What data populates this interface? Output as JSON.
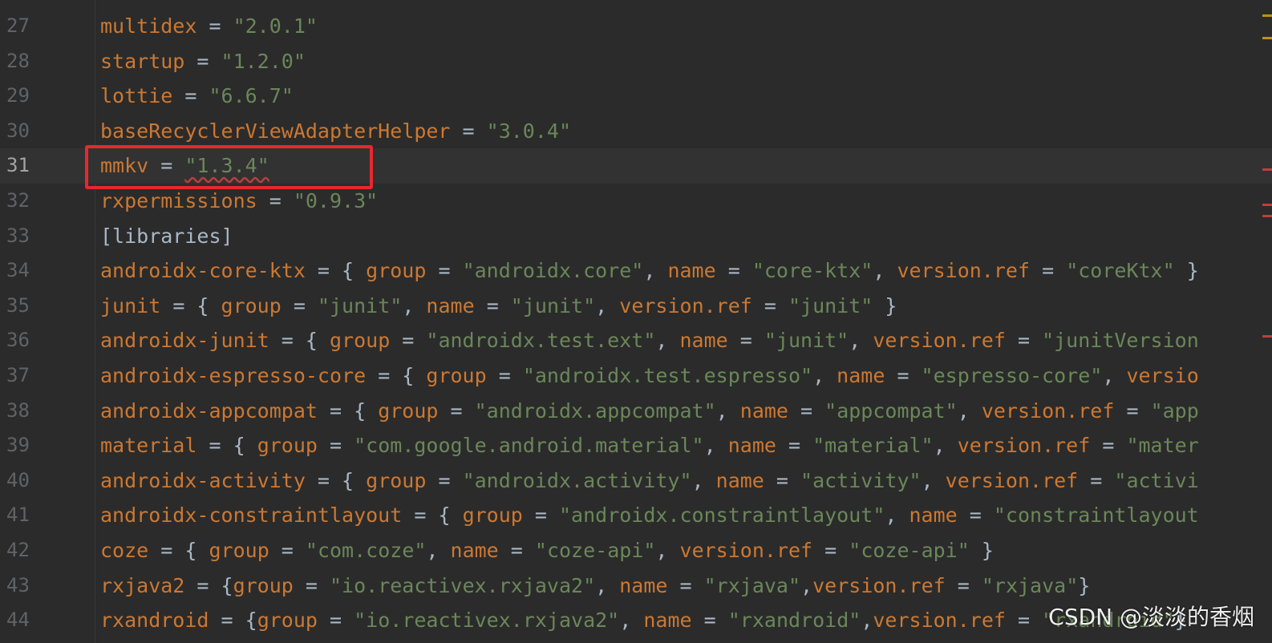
{
  "editor": {
    "lines": [
      {
        "n": "27",
        "t": [
          {
            "c": "k",
            "v": "multidex"
          },
          {
            "c": "p",
            "v": " = "
          },
          {
            "c": "s",
            "v": "\"2.0.1\""
          }
        ]
      },
      {
        "n": "28",
        "t": [
          {
            "c": "k",
            "v": "startup"
          },
          {
            "c": "p",
            "v": " = "
          },
          {
            "c": "s",
            "v": "\"1.2.0\""
          }
        ]
      },
      {
        "n": "29",
        "t": [
          {
            "c": "k",
            "v": "lottie"
          },
          {
            "c": "p",
            "v": " = "
          },
          {
            "c": "s",
            "v": "\"6.6.7\""
          }
        ]
      },
      {
        "n": "30",
        "t": [
          {
            "c": "k",
            "v": "baseRecyclerViewAdapterHelper"
          },
          {
            "c": "p",
            "v": " = "
          },
          {
            "c": "s",
            "v": "\"3.0.4\""
          }
        ]
      },
      {
        "n": "31",
        "current": true,
        "t": [
          {
            "c": "k",
            "v": "mmkv"
          },
          {
            "c": "p",
            "v": " = "
          },
          {
            "c": "s squiggle",
            "v": "\"1.3.4\""
          }
        ]
      },
      {
        "n": "32",
        "t": [
          {
            "c": "k",
            "v": "rxpermissions"
          },
          {
            "c": "p",
            "v": " = "
          },
          {
            "c": "s",
            "v": "\"0.9.3\""
          }
        ]
      },
      {
        "n": "33",
        "t": [
          {
            "c": "p",
            "v": "[libraries]"
          }
        ]
      },
      {
        "n": "34",
        "t": [
          {
            "c": "k",
            "v": "androidx-core-ktx"
          },
          {
            "c": "p",
            "v": " = { "
          },
          {
            "c": "k",
            "v": "group"
          },
          {
            "c": "p",
            "v": " = "
          },
          {
            "c": "s",
            "v": "\"androidx.core\""
          },
          {
            "c": "p",
            "v": ", "
          },
          {
            "c": "k",
            "v": "name"
          },
          {
            "c": "p",
            "v": " = "
          },
          {
            "c": "s",
            "v": "\"core-ktx\""
          },
          {
            "c": "p",
            "v": ", "
          },
          {
            "c": "k",
            "v": "version.ref"
          },
          {
            "c": "p",
            "v": " = "
          },
          {
            "c": "s",
            "v": "\"coreKtx\""
          },
          {
            "c": "p",
            "v": " }"
          }
        ]
      },
      {
        "n": "35",
        "t": [
          {
            "c": "k",
            "v": "junit"
          },
          {
            "c": "p",
            "v": " = { "
          },
          {
            "c": "k",
            "v": "group"
          },
          {
            "c": "p",
            "v": " = "
          },
          {
            "c": "s",
            "v": "\"junit\""
          },
          {
            "c": "p",
            "v": ", "
          },
          {
            "c": "k",
            "v": "name"
          },
          {
            "c": "p",
            "v": " = "
          },
          {
            "c": "s",
            "v": "\"junit\""
          },
          {
            "c": "p",
            "v": ", "
          },
          {
            "c": "k",
            "v": "version.ref"
          },
          {
            "c": "p",
            "v": " = "
          },
          {
            "c": "s",
            "v": "\"junit\""
          },
          {
            "c": "p",
            "v": " }"
          }
        ]
      },
      {
        "n": "36",
        "t": [
          {
            "c": "k",
            "v": "androidx-junit"
          },
          {
            "c": "p",
            "v": " = { "
          },
          {
            "c": "k",
            "v": "group"
          },
          {
            "c": "p",
            "v": " = "
          },
          {
            "c": "s",
            "v": "\"androidx.test.ext\""
          },
          {
            "c": "p",
            "v": ", "
          },
          {
            "c": "k",
            "v": "name"
          },
          {
            "c": "p",
            "v": " = "
          },
          {
            "c": "s",
            "v": "\"junit\""
          },
          {
            "c": "p",
            "v": ", "
          },
          {
            "c": "k",
            "v": "version.ref"
          },
          {
            "c": "p",
            "v": " = "
          },
          {
            "c": "s",
            "v": "\"junitVersion"
          }
        ]
      },
      {
        "n": "37",
        "t": [
          {
            "c": "k",
            "v": "androidx-espresso-core"
          },
          {
            "c": "p",
            "v": " = { "
          },
          {
            "c": "k",
            "v": "group"
          },
          {
            "c": "p",
            "v": " = "
          },
          {
            "c": "s",
            "v": "\"androidx.test.espresso\""
          },
          {
            "c": "p",
            "v": ", "
          },
          {
            "c": "k",
            "v": "name"
          },
          {
            "c": "p",
            "v": " = "
          },
          {
            "c": "s",
            "v": "\"espresso-core\""
          },
          {
            "c": "p",
            "v": ", "
          },
          {
            "c": "k",
            "v": "versio"
          }
        ]
      },
      {
        "n": "38",
        "t": [
          {
            "c": "k",
            "v": "androidx-appcompat"
          },
          {
            "c": "p",
            "v": " = { "
          },
          {
            "c": "k",
            "v": "group"
          },
          {
            "c": "p",
            "v": " = "
          },
          {
            "c": "s",
            "v": "\"androidx.appcompat\""
          },
          {
            "c": "p",
            "v": ", "
          },
          {
            "c": "k",
            "v": "name"
          },
          {
            "c": "p",
            "v": " = "
          },
          {
            "c": "s",
            "v": "\"appcompat\""
          },
          {
            "c": "p",
            "v": ", "
          },
          {
            "c": "k",
            "v": "version.ref"
          },
          {
            "c": "p",
            "v": " = "
          },
          {
            "c": "s",
            "v": "\"app"
          }
        ]
      },
      {
        "n": "39",
        "t": [
          {
            "c": "k",
            "v": "material"
          },
          {
            "c": "p",
            "v": " = { "
          },
          {
            "c": "k",
            "v": "group"
          },
          {
            "c": "p",
            "v": " = "
          },
          {
            "c": "s",
            "v": "\"com.google.android.material\""
          },
          {
            "c": "p",
            "v": ", "
          },
          {
            "c": "k",
            "v": "name"
          },
          {
            "c": "p",
            "v": " = "
          },
          {
            "c": "s",
            "v": "\"material\""
          },
          {
            "c": "p",
            "v": ", "
          },
          {
            "c": "k",
            "v": "version.ref"
          },
          {
            "c": "p",
            "v": " = "
          },
          {
            "c": "s",
            "v": "\"mater"
          }
        ]
      },
      {
        "n": "40",
        "t": [
          {
            "c": "k",
            "v": "androidx-activity"
          },
          {
            "c": "p",
            "v": " = { "
          },
          {
            "c": "k",
            "v": "group"
          },
          {
            "c": "p",
            "v": " = "
          },
          {
            "c": "s",
            "v": "\"androidx.activity\""
          },
          {
            "c": "p",
            "v": ", "
          },
          {
            "c": "k",
            "v": "name"
          },
          {
            "c": "p",
            "v": " = "
          },
          {
            "c": "s",
            "v": "\"activity\""
          },
          {
            "c": "p",
            "v": ", "
          },
          {
            "c": "k",
            "v": "version.ref"
          },
          {
            "c": "p",
            "v": " = "
          },
          {
            "c": "s",
            "v": "\"activi"
          }
        ]
      },
      {
        "n": "41",
        "t": [
          {
            "c": "k",
            "v": "androidx-constraintlayout"
          },
          {
            "c": "p",
            "v": " = { "
          },
          {
            "c": "k",
            "v": "group"
          },
          {
            "c": "p",
            "v": " = "
          },
          {
            "c": "s",
            "v": "\"androidx.constraintlayout\""
          },
          {
            "c": "p",
            "v": ", "
          },
          {
            "c": "k",
            "v": "name"
          },
          {
            "c": "p",
            "v": " = "
          },
          {
            "c": "s",
            "v": "\"constraintlayout"
          }
        ]
      },
      {
        "n": "42",
        "t": [
          {
            "c": "k",
            "v": "coze"
          },
          {
            "c": "p",
            "v": " = { "
          },
          {
            "c": "k",
            "v": "group"
          },
          {
            "c": "p",
            "v": " = "
          },
          {
            "c": "s",
            "v": "\"com.coze\""
          },
          {
            "c": "p",
            "v": ", "
          },
          {
            "c": "k",
            "v": "name"
          },
          {
            "c": "p",
            "v": " = "
          },
          {
            "c": "s",
            "v": "\"coze-api\""
          },
          {
            "c": "p",
            "v": ", "
          },
          {
            "c": "k",
            "v": "version.ref"
          },
          {
            "c": "p",
            "v": " = "
          },
          {
            "c": "s",
            "v": "\"coze-api\""
          },
          {
            "c": "p",
            "v": " }"
          }
        ]
      },
      {
        "n": "43",
        "t": [
          {
            "c": "k",
            "v": "rxjava2"
          },
          {
            "c": "p",
            "v": " = {"
          },
          {
            "c": "k",
            "v": "group"
          },
          {
            "c": "p",
            "v": " = "
          },
          {
            "c": "s",
            "v": "\"io.reactivex.rxjava2\""
          },
          {
            "c": "p",
            "v": ", "
          },
          {
            "c": "k",
            "v": "name"
          },
          {
            "c": "p",
            "v": " = "
          },
          {
            "c": "s",
            "v": "\"rxjava\""
          },
          {
            "c": "p",
            "v": ","
          },
          {
            "c": "k",
            "v": "version.ref"
          },
          {
            "c": "p",
            "v": " = "
          },
          {
            "c": "s",
            "v": "\"rxjava\""
          },
          {
            "c": "p",
            "v": "}"
          }
        ]
      },
      {
        "n": "44",
        "t": [
          {
            "c": "k",
            "v": "rxandroid"
          },
          {
            "c": "p",
            "v": " = {"
          },
          {
            "c": "k",
            "v": "group"
          },
          {
            "c": "p",
            "v": " = "
          },
          {
            "c": "s",
            "v": "\"io.reactivex.rxjava2\""
          },
          {
            "c": "p",
            "v": ", "
          },
          {
            "c": "k",
            "v": "name"
          },
          {
            "c": "p",
            "v": " = "
          },
          {
            "c": "s",
            "v": "\"rxandroid\""
          },
          {
            "c": "p",
            "v": ","
          },
          {
            "c": "k",
            "v": "version.ref"
          },
          {
            "c": "p",
            "v": " = "
          },
          {
            "c": "s",
            "v": "\"rxandroid\""
          },
          {
            "c": "p",
            "v": "}"
          }
        ]
      }
    ]
  },
  "watermark": "CSDN @淡淡的香烟",
  "colors": {
    "background": "#2b2b2b",
    "current_line": "#323232",
    "key": "#cc7832",
    "string": "#6a8759",
    "punct": "#a9b7c6",
    "highlight_box": "#e8282e",
    "error_marker": "#bc3f3c",
    "warning_marker": "#be9117"
  },
  "scrollbar_markers": [
    {
      "kind": "warning"
    },
    {
      "kind": "warning"
    },
    {
      "kind": "error"
    },
    {
      "kind": "error"
    },
    {
      "kind": "error"
    },
    {
      "kind": "error"
    }
  ]
}
